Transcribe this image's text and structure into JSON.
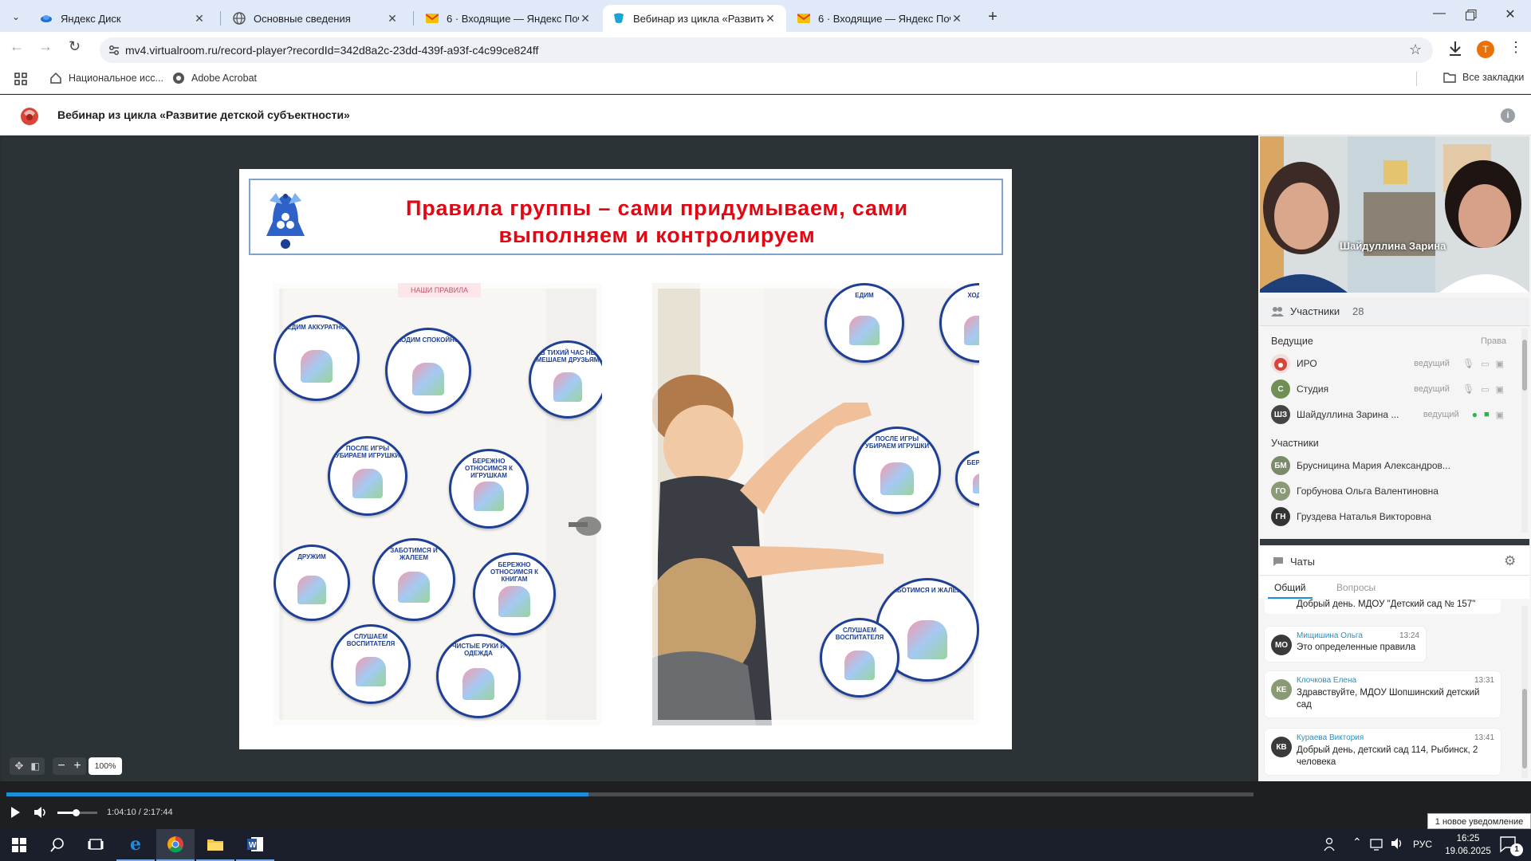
{
  "tabs": [
    {
      "title": "Яндекс Диск",
      "active": false
    },
    {
      "title": "Основные сведения",
      "active": false
    },
    {
      "title": "6 · Входящие — Яндекс Почта",
      "active": false
    },
    {
      "title": "Вебинар из цикла «Развитие д",
      "active": true
    },
    {
      "title": "6 · Входящие — Яндекс Почта",
      "active": false
    }
  ],
  "address": {
    "url": "mv4.virtualroom.ru/record-player?recordId=342d8a2c-23dd-439f-a93f-c4c99ce824ff",
    "profile_initial": "Т"
  },
  "bookmarks": {
    "items": [
      "Национальное исс...",
      "Adobe Acrobat"
    ],
    "all": "Все закладки"
  },
  "app": {
    "title": "Вебинар из цикла «Развитие детской субъектности»"
  },
  "slide": {
    "title_line1": "Правила группы – сами придумываем, сами",
    "title_line2": "выполняем и контролируем",
    "sign": "НАШИ ПРАВИЛА",
    "circles_left": [
      "ЕДИМ АККУРАТНО",
      "ХОДИМ СПОКОЙНО",
      "В ТИХИЙ ЧАС НЕ МЕШАЕМ ДРУЗЬЯМ",
      "ПОСЛЕ ИГРЫ УБИРАЕМ ИГРУШКИ",
      "БЕРЕЖНО ОТНОСИМСЯ К ИГРУШКАМ",
      "ДРУЖИМ",
      "ЗАБОТИМСЯ И ЖАЛЕЕМ",
      "БЕРЕЖНО ОТНОСИМСЯ К КНИГАМ",
      "СЛУШАЕМ ВОСПИТАТЕЛЯ",
      "ЧИСТЫЕ РУКИ И ОДЕЖДА"
    ],
    "circles_right": [
      "ЕДИМ",
      "ХОДИМ",
      "ПОСЛЕ ИГРЫ УБИРАЕМ ИГРУШКИ",
      "БЕРЕЖНО",
      "ЗАБОТИМСЯ И ЖАЛЕЕМ",
      "СЛУШАЕМ ВОСПИТАТЕЛЯ"
    ]
  },
  "zoom": {
    "level": "100%",
    "minus": "−",
    "plus": "+"
  },
  "video": {
    "speaker_name": "Шайдуллина Зарина"
  },
  "participants": {
    "title": "Участники",
    "count": "28",
    "hosts_label": "Ведущие",
    "rights_label": "Права",
    "hosts": [
      {
        "initials": "",
        "name": "ИРО",
        "role": "ведущий",
        "color": "#c94a3a"
      },
      {
        "initials": "С",
        "name": "Студия",
        "role": "ведущий",
        "color": "#6f8f55"
      },
      {
        "initials": "ШЗ",
        "name": "Шайдуллина Зарина ...",
        "role": "ведущий",
        "color": "#444444"
      }
    ],
    "members_label": "Участники",
    "members": [
      {
        "initials": "БМ",
        "name": "Брусницина Мария Александров...",
        "color": "#7a8b6a"
      },
      {
        "initials": "ГО",
        "name": "Горбунова Ольга Валентиновна",
        "color": "#8a9a74"
      },
      {
        "initials": "ГН",
        "name": "Груздева Наталья Викторовна",
        "color": "#333333"
      }
    ]
  },
  "chats": {
    "title": "Чаты",
    "tab_general": "Общий",
    "tab_questions": "Вопросы",
    "partial_message": "Добрый день. МДОУ \"Детский сад № 157\"",
    "messages": [
      {
        "initials": "МО",
        "author": "Мищишина Ольга",
        "time": "13:24",
        "text": "Это определенные правила"
      },
      {
        "initials": "КЕ",
        "author": "Клочкова Елена",
        "time": "13:31",
        "text": "Здравствуйте, МДОУ Шопшинский детский сад"
      },
      {
        "initials": "КВ",
        "author": "Кураева Виктория",
        "time": "13:41",
        "text": "Добрый день, детский сад 114, Рыбинск, 2 человека"
      }
    ]
  },
  "player": {
    "time": "1:04:10 / 2:17:44",
    "progress": 0.467,
    "volume": 0.45
  },
  "notification": {
    "text": "1 новое уведомление"
  },
  "taskbar": {
    "lang": "РУС",
    "time": "16:25",
    "date": "19.06.2025",
    "notif_count": "1"
  },
  "colors": {
    "accent": "#1a8fd8",
    "title_red": "#e30613",
    "title_blue": "#1b3f95"
  }
}
